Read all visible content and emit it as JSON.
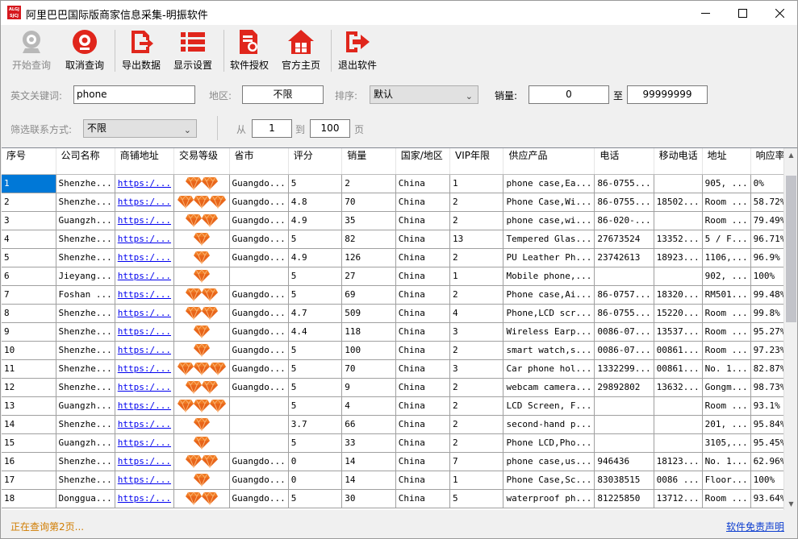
{
  "window": {
    "title": "阿里巴巴国际版商家信息采集-明振软件",
    "logo_text": "ALGJ SJCJ",
    "controls": [
      "minimize",
      "maximize",
      "close"
    ]
  },
  "toolbar": {
    "start": "开始查询",
    "cancel": "取消查询",
    "export": "导出数据",
    "display": "显示设置",
    "license": "软件授权",
    "home": "官方主页",
    "exit": "退出软件"
  },
  "filters": {
    "keyword_label": "英文关键词:",
    "keyword_value": "phone",
    "region_label": "地区:",
    "region_value": "不限",
    "sort_label": "排序:",
    "sort_value": "默认",
    "sales_label": "销量:",
    "sales_min": "0",
    "sales_to": "至",
    "sales_max": "99999999",
    "contact_label": "筛选联系方式:",
    "contact_value": "不限",
    "page_from_label": "从",
    "page_from": "1",
    "page_to_label": "到",
    "page_to": "100",
    "page_unit": "页"
  },
  "table": {
    "headers": [
      "序号",
      "公司名称",
      "商铺地址",
      "交易等级",
      "省市",
      "评分",
      "销量",
      "国家/地区",
      "VIP年限",
      "供应产品",
      "电话",
      "移动电话",
      "地址",
      "响应率"
    ],
    "rows": [
      [
        "1",
        "Shenzhe...",
        "https:/...",
        2,
        "Guangdo...",
        "5",
        "2",
        "China",
        "1",
        "phone case,Ea...",
        "86-0755...",
        "",
        "905, ...",
        "0%"
      ],
      [
        "2",
        "Shenzhe...",
        "https:/...",
        3,
        "Guangdo...",
        "4.8",
        "70",
        "China",
        "2",
        "Phone Case,Wi...",
        "86-0755...",
        "18502...",
        "Room ...",
        "58.72%"
      ],
      [
        "3",
        "Guangzh...",
        "https:/...",
        2,
        "Guangdo...",
        "4.9",
        "35",
        "China",
        "2",
        "phone case,wi...",
        "86-020-...",
        "",
        "Room ...",
        "79.49%"
      ],
      [
        "4",
        "Shenzhe...",
        "https:/...",
        1,
        "Guangdo...",
        "5",
        "82",
        "China",
        "13",
        "Tempered Glas...",
        "27673524",
        "13352...",
        "5 / F...",
        "96.71%"
      ],
      [
        "5",
        "Shenzhe...",
        "https:/...",
        1,
        "Guangdo...",
        "4.9",
        "126",
        "China",
        "2",
        "PU Leather Ph...",
        "23742613",
        "18923...",
        "1106,...",
        "96.9%"
      ],
      [
        "6",
        "Jieyang...",
        "https:/...",
        1,
        "",
        "5",
        "27",
        "China",
        "1",
        "Mobile phone,...",
        "",
        "",
        "902, ...",
        "100%"
      ],
      [
        "7",
        "Foshan ...",
        "https:/...",
        2,
        "Guangdo...",
        "5",
        "69",
        "China",
        "2",
        "Phone case,Ai...",
        "86-0757...",
        "18320...",
        "RM501...",
        "99.48%"
      ],
      [
        "8",
        "Shenzhe...",
        "https:/...",
        2,
        "Guangdo...",
        "4.7",
        "509",
        "China",
        "4",
        "Phone,LCD scr...",
        "86-0755...",
        "15220...",
        "Room ...",
        "99.8%"
      ],
      [
        "9",
        "Shenzhe...",
        "https:/...",
        1,
        "Guangdo...",
        "4.4",
        "118",
        "China",
        "3",
        "Wireless Earp...",
        "0086-07...",
        "13537...",
        "Room ...",
        "95.27%"
      ],
      [
        "10",
        "Shenzhe...",
        "https:/...",
        1,
        "Guangdo...",
        "5",
        "100",
        "China",
        "2",
        "smart watch,s...",
        "0086-07...",
        "00861...",
        "Room ...",
        "97.23%"
      ],
      [
        "11",
        "Shenzhe...",
        "https:/...",
        3,
        "Guangdo...",
        "5",
        "70",
        "China",
        "3",
        "Car phone hol...",
        "1332299...",
        "00861...",
        "No. 1...",
        "82.87%"
      ],
      [
        "12",
        "Shenzhe...",
        "https:/...",
        2,
        "Guangdo...",
        "5",
        "9",
        "China",
        "2",
        "webcam camera...",
        "29892802",
        "13632...",
        "Gongm...",
        "98.73%"
      ],
      [
        "13",
        "Guangzh...",
        "https:/...",
        3,
        "",
        "5",
        "4",
        "China",
        "2",
        "LCD Screen, F...",
        "",
        "",
        "Room ...",
        "93.1%"
      ],
      [
        "14",
        "Shenzhe...",
        "https:/...",
        1,
        "",
        "3.7",
        "66",
        "China",
        "2",
        "second-hand p...",
        "",
        "",
        "201, ...",
        "95.84%"
      ],
      [
        "15",
        "Guangzh...",
        "https:/...",
        1,
        "",
        "5",
        "33",
        "China",
        "2",
        "Phone LCD,Pho...",
        "",
        "",
        "3105,...",
        "95.45%"
      ],
      [
        "16",
        "Shenzhe...",
        "https:/...",
        2,
        "Guangdo...",
        "0",
        "14",
        "China",
        "7",
        "phone case,us...",
        "946436",
        "18123...",
        "No. 1...",
        "62.96%"
      ],
      [
        "17",
        "Shenzhe...",
        "https:/...",
        1,
        "Guangdo...",
        "0",
        "14",
        "China",
        "1",
        "Phone Case,Sc...",
        "83038515",
        "0086 ...",
        "Floor...",
        "100%"
      ],
      [
        "18",
        "Donggua...",
        "https:/...",
        2,
        "Guangdo...",
        "5",
        "30",
        "China",
        "5",
        "waterproof ph...",
        "81225850",
        "13712...",
        "Room ...",
        "93.64%"
      ]
    ]
  },
  "status": {
    "left": "正在查询第2页...",
    "right": "软件免责声明"
  },
  "colors": {
    "status_text": "#d07c00",
    "link": "#0b3ccf",
    "selection": "#0078d7",
    "diamond": "#f07a22",
    "toolbar_icon_red": "#e0261c"
  }
}
